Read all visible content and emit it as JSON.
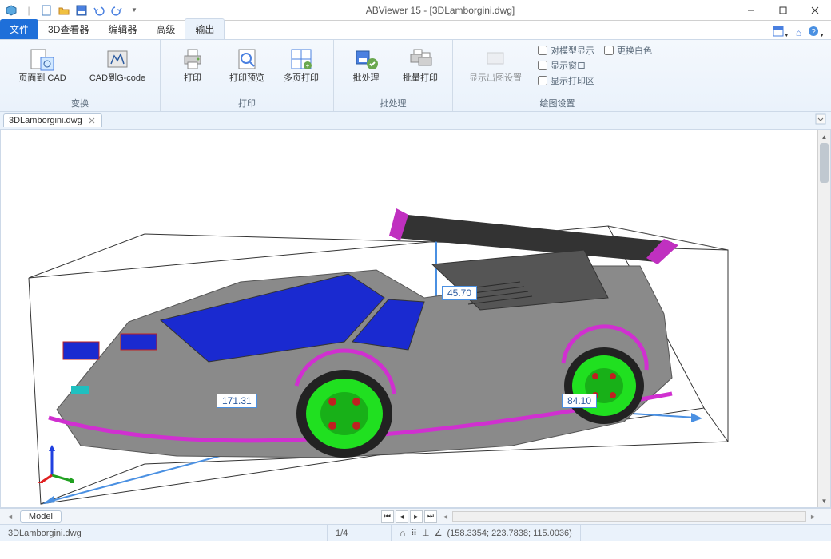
{
  "window": {
    "title": "ABViewer 15 - [3DLamborgini.dwg]"
  },
  "tabs": {
    "file": "文件",
    "viewer3d": "3D查看器",
    "editor": "编辑器",
    "advanced": "高级",
    "output": "输出"
  },
  "ribbon": {
    "convert": {
      "label": "变换",
      "page_to_cad": "页面到 CAD",
      "cad_to_gcode": "CAD到G-code"
    },
    "print": {
      "label": "打印",
      "print": "打印",
      "preview": "打印预览",
      "multipage": "多页打印"
    },
    "batch": {
      "label": "批处理",
      "batch": "批处理",
      "batch_print": "批量打印"
    },
    "plot": {
      "label": "绘图设置",
      "show_settings": "显示出图设置",
      "model_display": "对模型显示",
      "show_window": "显示窗口",
      "show_print_area": "显示打印区",
      "swap_white": "更换白色"
    }
  },
  "doc": {
    "tab_name": "3DLamborgini.dwg"
  },
  "dimensions": {
    "height": "45.70",
    "length": "171.31",
    "width": "84.10"
  },
  "bottom": {
    "model_tab": "Model"
  },
  "status": {
    "filename": "3DLamborgini.dwg",
    "page": "1/4",
    "coords": "(158.3354; 223.7838; 115.0036)"
  }
}
